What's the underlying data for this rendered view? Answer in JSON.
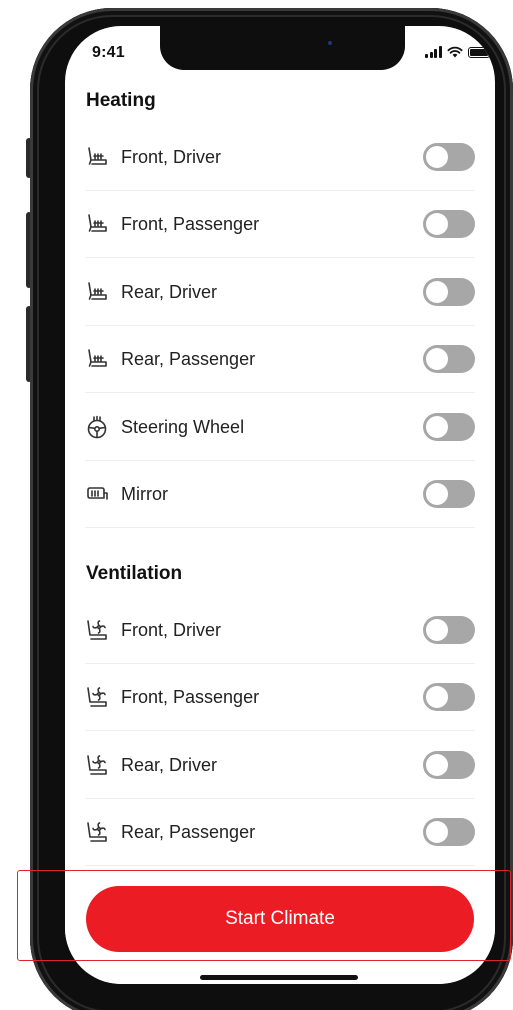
{
  "status_bar": {
    "time": "9:41"
  },
  "heating": {
    "title": "Heating",
    "items": [
      {
        "label": "Front, Driver",
        "icon": "heated-seat-icon",
        "on": false
      },
      {
        "label": "Front, Passenger",
        "icon": "heated-seat-icon",
        "on": false
      },
      {
        "label": "Rear, Driver",
        "icon": "heated-seat-icon",
        "on": false
      },
      {
        "label": "Rear, Passenger",
        "icon": "heated-seat-icon",
        "on": false
      },
      {
        "label": "Steering Wheel",
        "icon": "heated-steering-wheel-icon",
        "on": false
      },
      {
        "label": "Mirror",
        "icon": "heated-mirror-icon",
        "on": false
      }
    ]
  },
  "ventilation": {
    "title": "Ventilation",
    "items": [
      {
        "label": "Front, Driver",
        "icon": "ventilated-seat-icon",
        "on": false
      },
      {
        "label": "Front, Passenger",
        "icon": "ventilated-seat-icon",
        "on": false
      },
      {
        "label": "Rear, Driver",
        "icon": "ventilated-seat-icon",
        "on": false
      },
      {
        "label": "Rear, Passenger",
        "icon": "ventilated-seat-icon",
        "on": false
      }
    ]
  },
  "actions": {
    "start_label": "Start Climate"
  },
  "colors": {
    "accent": "#ec1c24",
    "toggle_off": "#a7a7a7",
    "highlight": "#d9262e",
    "text": "#222222"
  }
}
